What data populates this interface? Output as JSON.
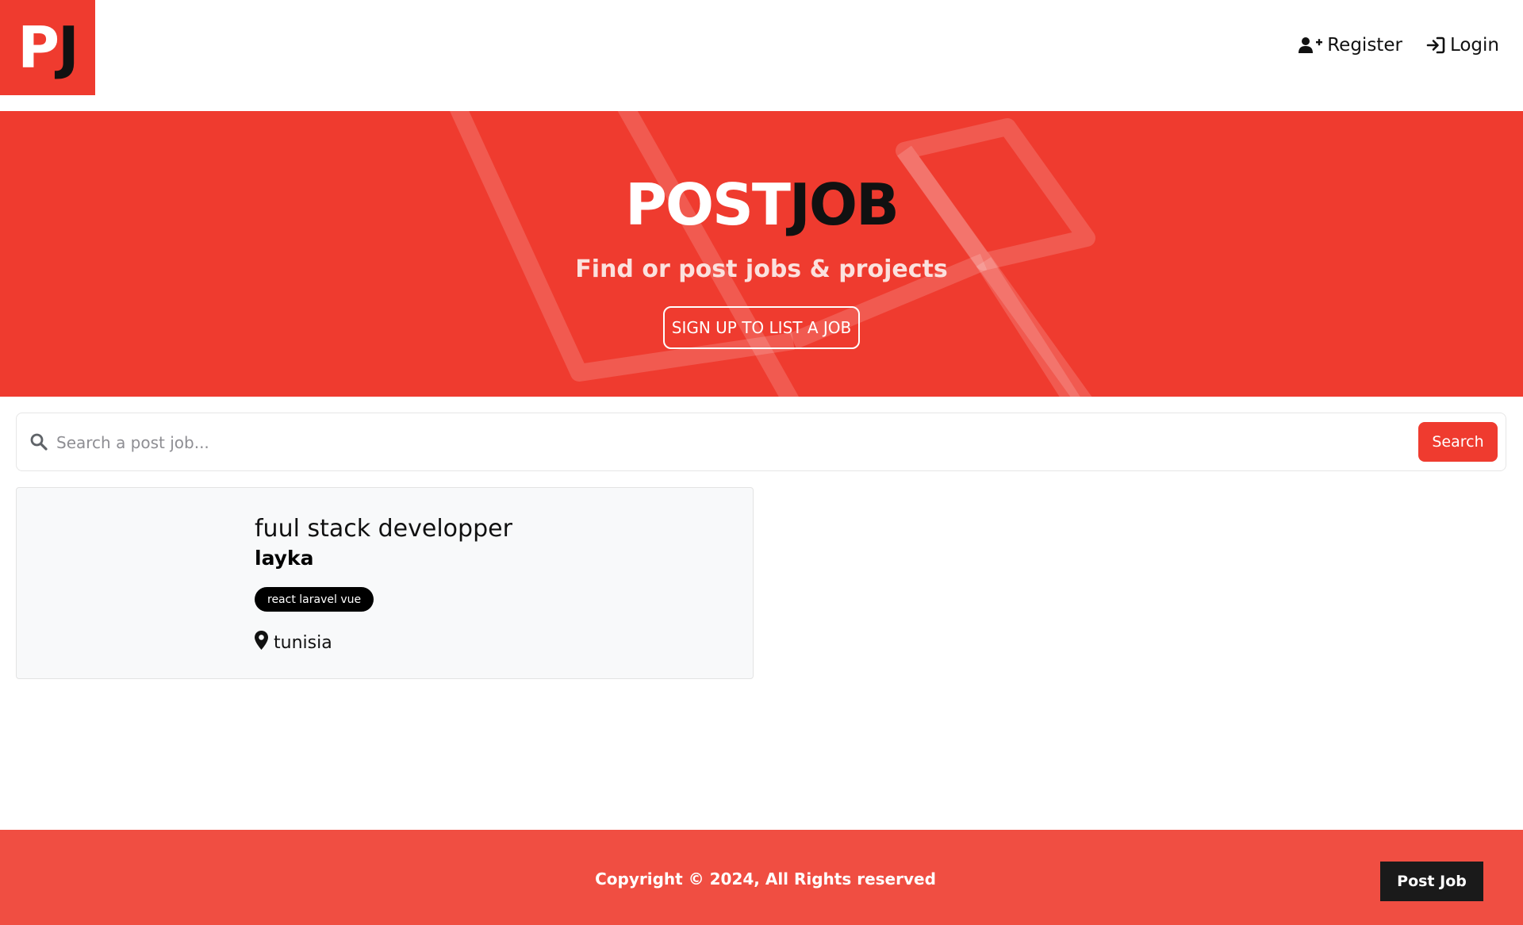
{
  "header": {
    "logo": {
      "letter_white": "P",
      "letter_black": "J"
    },
    "nav": {
      "register_label": "Register",
      "login_label": "Login",
      "register_icon": "user-plus-icon",
      "login_icon": "sign-in-icon"
    }
  },
  "hero": {
    "title_white": "POST",
    "title_black": "JOB",
    "subtitle": "Find or post jobs & projects",
    "cta_label": "SIGN UP TO LIST A JOB",
    "background_icon": "laravel-logo-watermark"
  },
  "search": {
    "placeholder": "Search a post job...",
    "value": "",
    "button_label": "Search",
    "icon": "search-icon"
  },
  "jobs": [
    {
      "title": "fuul stack developper",
      "company": "layka",
      "tags": "react laravel vue",
      "location": "tunisia",
      "location_icon": "map-marker-icon"
    }
  ],
  "footer": {
    "copyright": "Copyright © 2024, All Rights reserved",
    "post_job_label": "Post Job"
  },
  "colors": {
    "brand": "#ef3b2f",
    "footer": "#f04e42",
    "dark": "#111111",
    "card_bg": "#f8f9fa"
  }
}
